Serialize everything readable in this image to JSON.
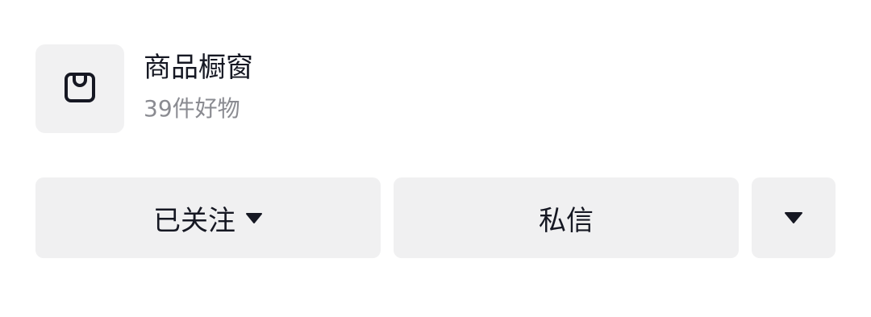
{
  "shop": {
    "title": "商品橱窗",
    "subtitle": "39件好物",
    "icon": "shopping-bag-icon"
  },
  "actions": {
    "follow_label": "已关注",
    "message_label": "私信",
    "more_icon": "caret-down-icon"
  },
  "colors": {
    "text_primary": "#161823",
    "text_secondary": "#8a8b91",
    "surface": "#f0f0f1"
  }
}
